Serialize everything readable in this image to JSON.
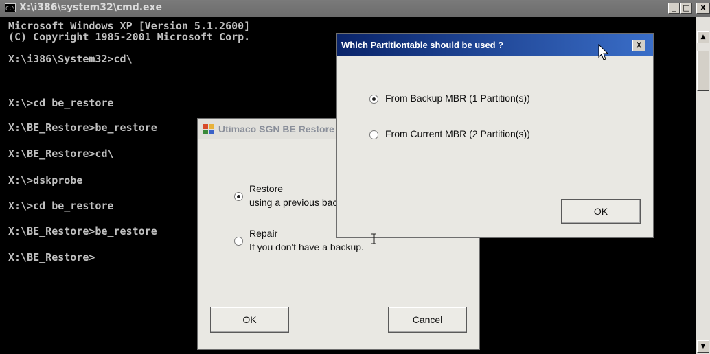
{
  "cmd": {
    "title": "X:\\i386\\system32\\cmd.exe",
    "icon_label": "C:\\",
    "minimize_symbol": "_",
    "restore_symbol": "□",
    "close_symbol": "X",
    "lines": [
      "Microsoft Windows XP [Version 5.1.2600]",
      "(C) Copyright 1985-2001 Microsoft Corp.",
      "",
      "X:\\i386\\System32>cd\\",
      "",
      "X:\\>cd be_restore",
      "",
      "X:\\BE_Restore>be_restore",
      "",
      "X:\\BE_Restore>cd\\",
      "",
      "X:\\>dskprobe",
      "",
      "X:\\>cd be_restore",
      "",
      "X:\\BE_Restore>be_restore",
      "",
      "X:\\BE_Restore>"
    ],
    "scroll_up_symbol": "▲",
    "scroll_down_symbol": "▼"
  },
  "utimaco_dialog": {
    "title": "Utimaco SGN BE Restore",
    "options": [
      {
        "label": "Restore",
        "description": "using a previous backup.",
        "selected": true
      },
      {
        "label": "Repair",
        "description": "If you don't have a backup.",
        "selected": false
      }
    ],
    "ok_label": "OK",
    "cancel_label": "Cancel"
  },
  "partition_dialog": {
    "title": "Which Partitiontable should be used ?",
    "close_symbol": "X",
    "options": [
      {
        "label": "From Backup MBR (1 Partition(s))",
        "selected": true
      },
      {
        "label": "From Current MBR (2 Partition(s))",
        "selected": false
      }
    ],
    "ok_label": "OK"
  }
}
